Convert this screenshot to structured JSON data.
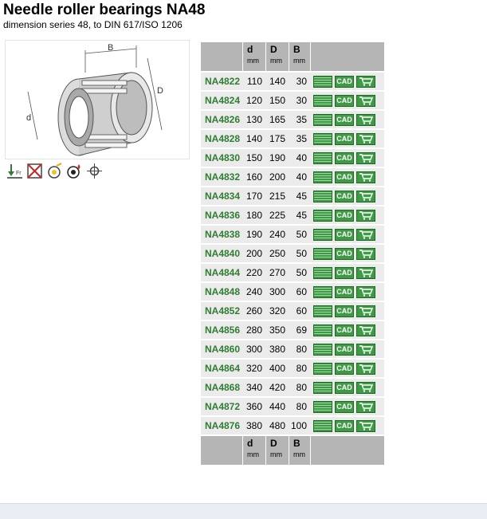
{
  "page": {
    "title": "Needle roller bearings NA48",
    "subtitle": "dimension series 48, to DIN 617/ISO 1206"
  },
  "drawing": {
    "label_B": "B",
    "label_D": "D",
    "label_d": "d"
  },
  "feature_icons": [
    {
      "icon": "axial-load-icon",
      "label": "Fr"
    },
    {
      "icon": "not-suitable-icon"
    },
    {
      "icon": "speed-suitability-icon"
    },
    {
      "icon": "lubrication-icon"
    },
    {
      "icon": "alignment-icon"
    }
  ],
  "table": {
    "header": [
      {
        "symbol": "d",
        "unit": "mm"
      },
      {
        "symbol": "D",
        "unit": "mm"
      },
      {
        "symbol": "B",
        "unit": "mm"
      }
    ],
    "cad_label": "CAD",
    "rows": [
      {
        "designation": "NA4822",
        "d": "110",
        "D": "140",
        "B": "30"
      },
      {
        "designation": "NA4824",
        "d": "120",
        "D": "150",
        "B": "30"
      },
      {
        "designation": "NA4826",
        "d": "130",
        "D": "165",
        "B": "35"
      },
      {
        "designation": "NA4828",
        "d": "140",
        "D": "175",
        "B": "35"
      },
      {
        "designation": "NA4830",
        "d": "150",
        "D": "190",
        "B": "40"
      },
      {
        "designation": "NA4832",
        "d": "160",
        "D": "200",
        "B": "40"
      },
      {
        "designation": "NA4834",
        "d": "170",
        "D": "215",
        "B": "45"
      },
      {
        "designation": "NA4836",
        "d": "180",
        "D": "225",
        "B": "45"
      },
      {
        "designation": "NA4838",
        "d": "190",
        "D": "240",
        "B": "50"
      },
      {
        "designation": "NA4840",
        "d": "200",
        "D": "250",
        "B": "50"
      },
      {
        "designation": "NA4844",
        "d": "220",
        "D": "270",
        "B": "50"
      },
      {
        "designation": "NA4848",
        "d": "240",
        "D": "300",
        "B": "60"
      },
      {
        "designation": "NA4852",
        "d": "260",
        "D": "320",
        "B": "60"
      },
      {
        "designation": "NA4856",
        "d": "280",
        "D": "350",
        "B": "69"
      },
      {
        "designation": "NA4860",
        "d": "300",
        "D": "380",
        "B": "80"
      },
      {
        "designation": "NA4864",
        "d": "320",
        "D": "400",
        "B": "80"
      },
      {
        "designation": "NA4868",
        "d": "340",
        "D": "420",
        "B": "80"
      },
      {
        "designation": "NA4872",
        "d": "360",
        "D": "440",
        "B": "80"
      },
      {
        "designation": "NA4876",
        "d": "380",
        "D": "480",
        "B": "100"
      }
    ]
  },
  "colors": {
    "designation": "#2f7d32",
    "header_bg": "#b5b5b5",
    "row_bg": "#ebebeb",
    "button_green": "#3f9a46"
  }
}
